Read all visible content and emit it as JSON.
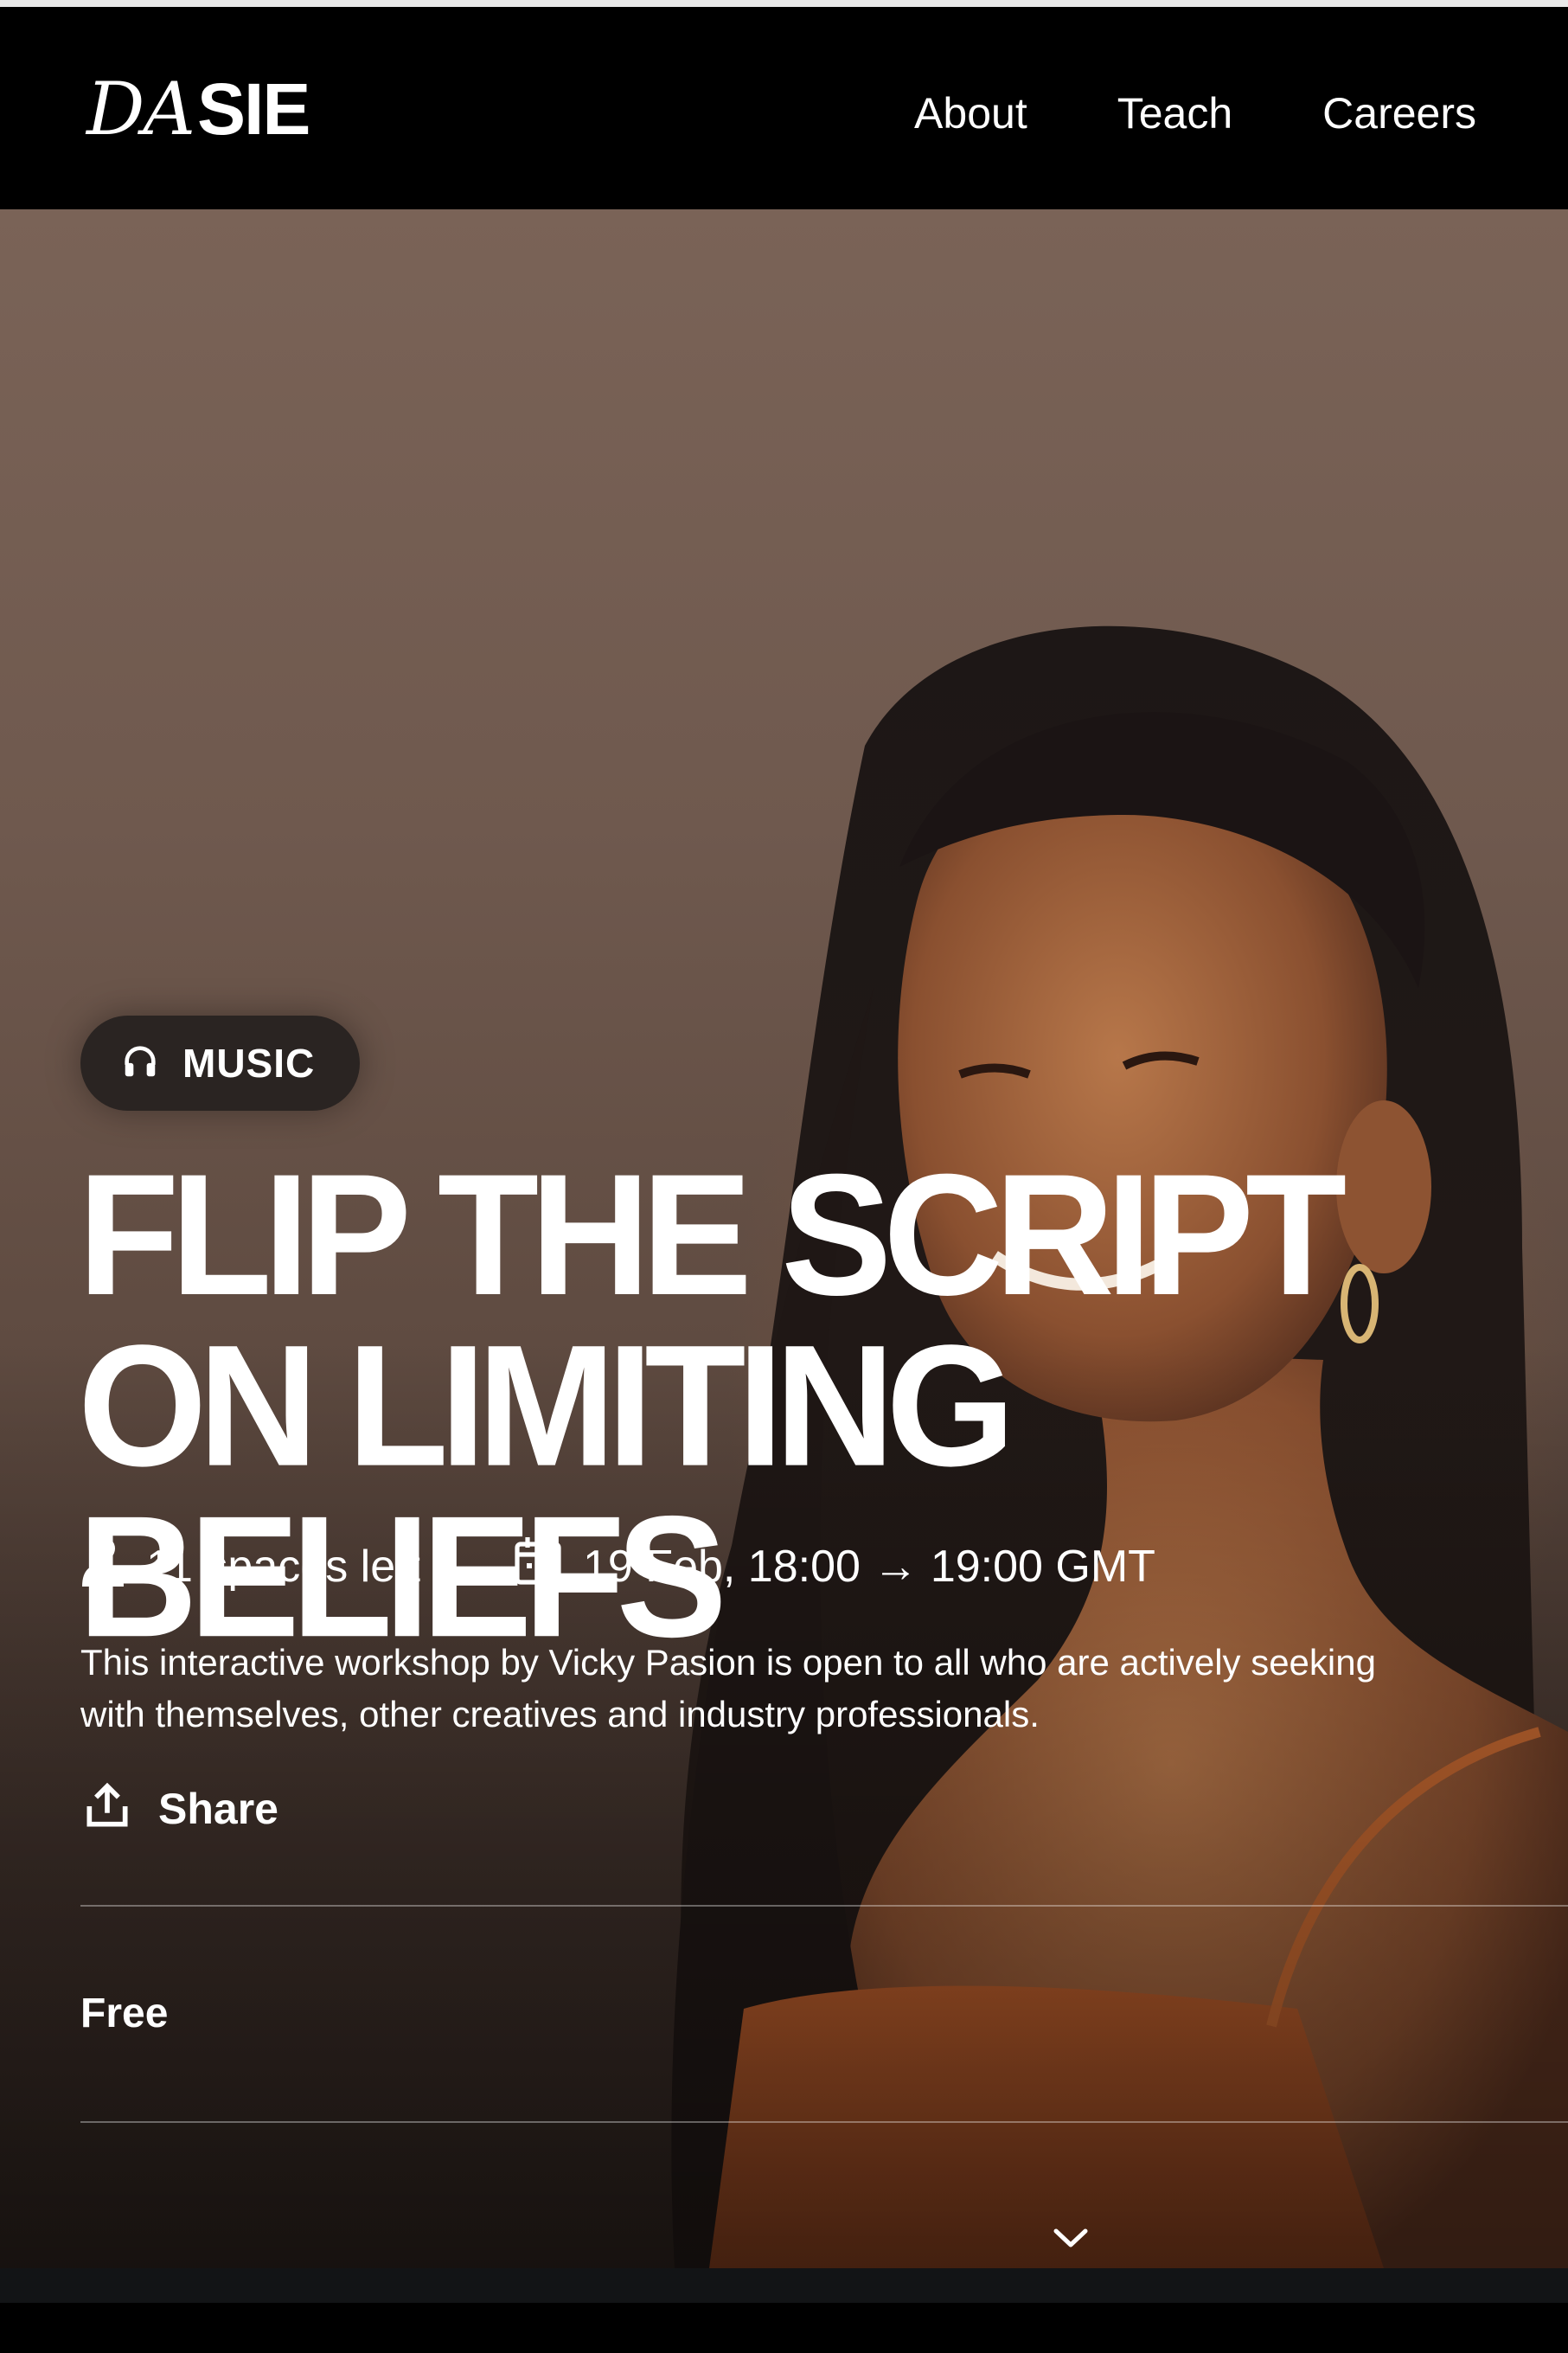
{
  "brand": {
    "logo_script": "DA",
    "logo_bold": "SIE"
  },
  "nav": {
    "links": [
      "About",
      "Teach",
      "Careers"
    ]
  },
  "hero": {
    "category": {
      "icon": "headphones-icon",
      "label": "MUSIC"
    },
    "title": "FLIP THE SCRIPT ON LIMITING BELIEFS",
    "spaces": {
      "icon": "user-icon",
      "text": "11 spaces left"
    },
    "schedule": {
      "icon": "calendar-icon",
      "text": "19 Feb, 18:00 → 19:00 GMT"
    },
    "description": "This interactive workshop by Vicky Pasion is open to all who are actively seeking\nwith themselves, other creatives and industry professionals.",
    "share": {
      "icon": "share-icon",
      "label": "Share"
    },
    "price": "Free",
    "scroll_icon": "chevron-down-icon"
  },
  "colors": {
    "nav_bg": "#000000",
    "tag_bg": "#2a2422",
    "text": "#ffffff"
  }
}
